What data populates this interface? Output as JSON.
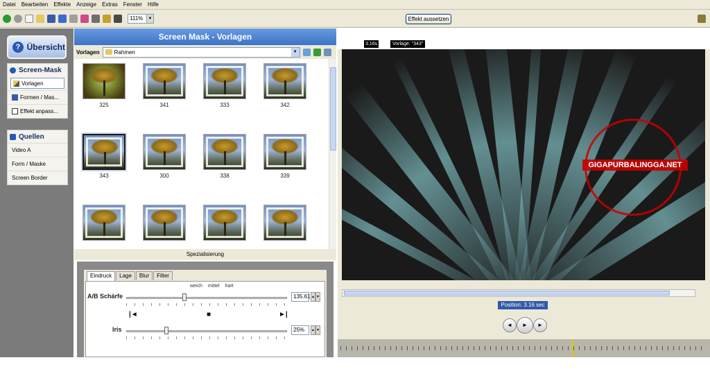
{
  "menu": [
    "Datei",
    "Bearbeiten",
    "Effekte",
    "Anzeige",
    "Extras",
    "Fenster",
    "Hilfe"
  ],
  "toolbar": {
    "zoom": "111%",
    "reset_label": "Effekt aussetzen"
  },
  "nav": {
    "overview": "Übersicht",
    "screen_mask_header": "Screen-Mask",
    "screen_mask_items": [
      "Vorlagen",
      "Formen / Mas...",
      "Effekt anpass..."
    ],
    "sources_header": "Quellen",
    "sources_items": [
      "Video A",
      "Form / Maske",
      "Screen Border"
    ]
  },
  "panel": {
    "title": "Screen Mask - Vorlagen",
    "vorlagen_label": "Vorlagen",
    "vorlagen_value": "Rahmen",
    "tiles": [
      "325",
      "341",
      "333",
      "342",
      "343",
      "300",
      "338",
      "339",
      "",
      "",
      "",
      ""
    ],
    "selected_tile": "343",
    "spec_label": "Spezialisierung"
  },
  "settings": {
    "tabs": [
      "Eindruck",
      "Lage",
      "Blur",
      "Filter"
    ],
    "ticks": [
      "weich",
      "mittel",
      "hart"
    ],
    "ab_label": "A/B Schärfe",
    "ab_value": "135.61",
    "ab_fraction": 0.36,
    "iris_label": "Iris",
    "iris_value": "25%",
    "iris_fraction": 0.25
  },
  "preview": {
    "time": "3.16s",
    "template": "Vorlage: \"343\"",
    "position": "Position: 3.16 sec",
    "watermark_text": "GIGAPURBALINGGA.NET"
  }
}
